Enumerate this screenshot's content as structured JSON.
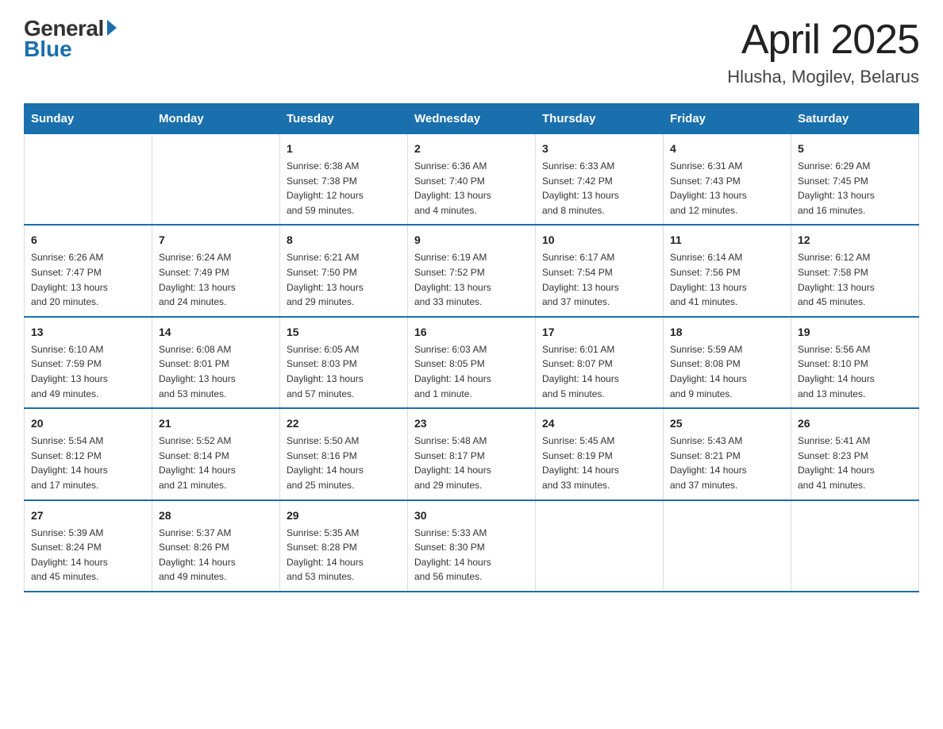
{
  "logo": {
    "general": "General",
    "blue": "Blue"
  },
  "title": "April 2025",
  "subtitle": "Hlusha, Mogilev, Belarus",
  "headers": [
    "Sunday",
    "Monday",
    "Tuesday",
    "Wednesday",
    "Thursday",
    "Friday",
    "Saturday"
  ],
  "weeks": [
    [
      {
        "day": "",
        "info": ""
      },
      {
        "day": "",
        "info": ""
      },
      {
        "day": "1",
        "info": "Sunrise: 6:38 AM\nSunset: 7:38 PM\nDaylight: 12 hours\nand 59 minutes."
      },
      {
        "day": "2",
        "info": "Sunrise: 6:36 AM\nSunset: 7:40 PM\nDaylight: 13 hours\nand 4 minutes."
      },
      {
        "day": "3",
        "info": "Sunrise: 6:33 AM\nSunset: 7:42 PM\nDaylight: 13 hours\nand 8 minutes."
      },
      {
        "day": "4",
        "info": "Sunrise: 6:31 AM\nSunset: 7:43 PM\nDaylight: 13 hours\nand 12 minutes."
      },
      {
        "day": "5",
        "info": "Sunrise: 6:29 AM\nSunset: 7:45 PM\nDaylight: 13 hours\nand 16 minutes."
      }
    ],
    [
      {
        "day": "6",
        "info": "Sunrise: 6:26 AM\nSunset: 7:47 PM\nDaylight: 13 hours\nand 20 minutes."
      },
      {
        "day": "7",
        "info": "Sunrise: 6:24 AM\nSunset: 7:49 PM\nDaylight: 13 hours\nand 24 minutes."
      },
      {
        "day": "8",
        "info": "Sunrise: 6:21 AM\nSunset: 7:50 PM\nDaylight: 13 hours\nand 29 minutes."
      },
      {
        "day": "9",
        "info": "Sunrise: 6:19 AM\nSunset: 7:52 PM\nDaylight: 13 hours\nand 33 minutes."
      },
      {
        "day": "10",
        "info": "Sunrise: 6:17 AM\nSunset: 7:54 PM\nDaylight: 13 hours\nand 37 minutes."
      },
      {
        "day": "11",
        "info": "Sunrise: 6:14 AM\nSunset: 7:56 PM\nDaylight: 13 hours\nand 41 minutes."
      },
      {
        "day": "12",
        "info": "Sunrise: 6:12 AM\nSunset: 7:58 PM\nDaylight: 13 hours\nand 45 minutes."
      }
    ],
    [
      {
        "day": "13",
        "info": "Sunrise: 6:10 AM\nSunset: 7:59 PM\nDaylight: 13 hours\nand 49 minutes."
      },
      {
        "day": "14",
        "info": "Sunrise: 6:08 AM\nSunset: 8:01 PM\nDaylight: 13 hours\nand 53 minutes."
      },
      {
        "day": "15",
        "info": "Sunrise: 6:05 AM\nSunset: 8:03 PM\nDaylight: 13 hours\nand 57 minutes."
      },
      {
        "day": "16",
        "info": "Sunrise: 6:03 AM\nSunset: 8:05 PM\nDaylight: 14 hours\nand 1 minute."
      },
      {
        "day": "17",
        "info": "Sunrise: 6:01 AM\nSunset: 8:07 PM\nDaylight: 14 hours\nand 5 minutes."
      },
      {
        "day": "18",
        "info": "Sunrise: 5:59 AM\nSunset: 8:08 PM\nDaylight: 14 hours\nand 9 minutes."
      },
      {
        "day": "19",
        "info": "Sunrise: 5:56 AM\nSunset: 8:10 PM\nDaylight: 14 hours\nand 13 minutes."
      }
    ],
    [
      {
        "day": "20",
        "info": "Sunrise: 5:54 AM\nSunset: 8:12 PM\nDaylight: 14 hours\nand 17 minutes."
      },
      {
        "day": "21",
        "info": "Sunrise: 5:52 AM\nSunset: 8:14 PM\nDaylight: 14 hours\nand 21 minutes."
      },
      {
        "day": "22",
        "info": "Sunrise: 5:50 AM\nSunset: 8:16 PM\nDaylight: 14 hours\nand 25 minutes."
      },
      {
        "day": "23",
        "info": "Sunrise: 5:48 AM\nSunset: 8:17 PM\nDaylight: 14 hours\nand 29 minutes."
      },
      {
        "day": "24",
        "info": "Sunrise: 5:45 AM\nSunset: 8:19 PM\nDaylight: 14 hours\nand 33 minutes."
      },
      {
        "day": "25",
        "info": "Sunrise: 5:43 AM\nSunset: 8:21 PM\nDaylight: 14 hours\nand 37 minutes."
      },
      {
        "day": "26",
        "info": "Sunrise: 5:41 AM\nSunset: 8:23 PM\nDaylight: 14 hours\nand 41 minutes."
      }
    ],
    [
      {
        "day": "27",
        "info": "Sunrise: 5:39 AM\nSunset: 8:24 PM\nDaylight: 14 hours\nand 45 minutes."
      },
      {
        "day": "28",
        "info": "Sunrise: 5:37 AM\nSunset: 8:26 PM\nDaylight: 14 hours\nand 49 minutes."
      },
      {
        "day": "29",
        "info": "Sunrise: 5:35 AM\nSunset: 8:28 PM\nDaylight: 14 hours\nand 53 minutes."
      },
      {
        "day": "30",
        "info": "Sunrise: 5:33 AM\nSunset: 8:30 PM\nDaylight: 14 hours\nand 56 minutes."
      },
      {
        "day": "",
        "info": ""
      },
      {
        "day": "",
        "info": ""
      },
      {
        "day": "",
        "info": ""
      }
    ]
  ]
}
